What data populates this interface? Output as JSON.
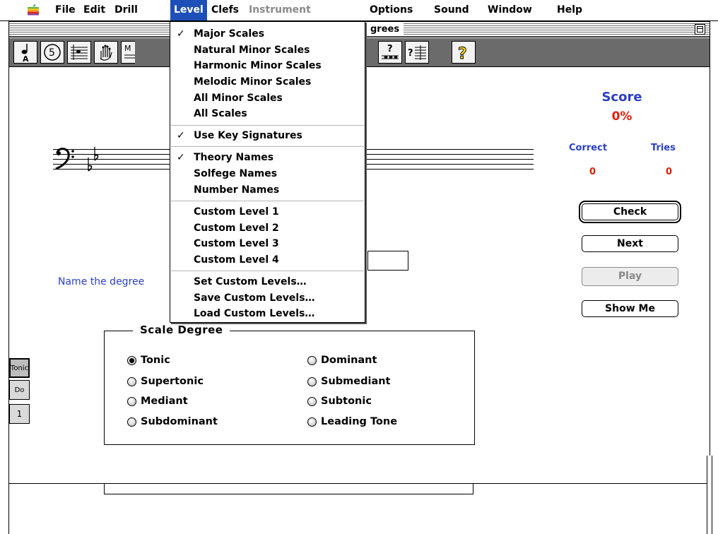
{
  "menubar": {
    "items": [
      "File",
      "Edit",
      "Drill",
      "Level",
      "Clefs",
      "Instrument",
      "Options",
      "Sound",
      "Window",
      "Help"
    ],
    "active": "Level",
    "disabled": [
      "Instrument"
    ]
  },
  "window": {
    "title": "grees"
  },
  "level_menu": {
    "scales": [
      "Major Scales",
      "Natural Minor Scales",
      "Harmonic Minor Scales",
      "Melodic Minor Scales",
      "All Minor Scales",
      "All Scales"
    ],
    "key_signatures": "Use Key Signatures",
    "names": [
      "Theory Names",
      "Solfege Names",
      "Number Names"
    ],
    "custom_levels": [
      "Custom Level  1",
      "Custom Level  2",
      "Custom Level  3",
      "Custom Level  4"
    ],
    "custom_actions": [
      "Set Custom Levels…",
      "Save Custom Levels…",
      "Load Custom Levels…"
    ],
    "checked": [
      "Major Scales",
      "Use Key Signatures",
      "Theory Names"
    ]
  },
  "score": {
    "label": "Score",
    "value": "0%",
    "correct_label": "Correct",
    "tries_label": "Tries",
    "correct": "0",
    "tries": "0"
  },
  "buttons": {
    "check": "Check",
    "next": "Next",
    "play": "Play",
    "show_me": "Show Me"
  },
  "prompt": "Name the degree",
  "scale_degree": {
    "legend": "Scale Degree",
    "options": [
      "Tonic",
      "Supertonic",
      "Mediant",
      "Subdominant",
      "Dominant",
      "Submediant",
      "Subtonic",
      "Leading Tone"
    ],
    "selected": "Tonic"
  },
  "name_toggles": [
    "Tonic",
    "Do",
    "1"
  ],
  "toolbar_icons": [
    "note-a-icon",
    "circle-five-icon",
    "staff-notes-icon",
    "hand-keys-icon",
    "major-scale-icon",
    "question-staff-icon",
    "question-staff-lines-icon",
    "help-icon"
  ],
  "toolbar_texts": {
    "note_letter": "A",
    "circle_number": "5",
    "question": "?"
  },
  "colors": {
    "accent_blue": "#2a3fc6",
    "score_red": "#e02010",
    "menu_highlight": "#1d4fb8",
    "toolbar_gray": "#6b6b6b"
  }
}
